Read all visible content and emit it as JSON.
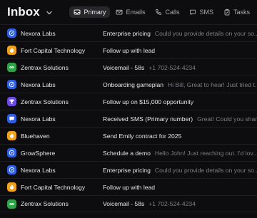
{
  "header": {
    "title": "Inbox",
    "tabs": [
      {
        "label": "Primary",
        "icon": "inbox-icon",
        "active": true
      },
      {
        "label": "Emails",
        "icon": "mail-icon",
        "active": false
      },
      {
        "label": "Calls",
        "icon": "phone-icon",
        "active": false
      },
      {
        "label": "SMS",
        "icon": "chat-icon",
        "active": false
      },
      {
        "label": "Tasks",
        "icon": "clipboard-icon",
        "active": false
      }
    ]
  },
  "colors": {
    "blue": "#2f5fe0",
    "orange": "#f0a21c",
    "green": "#2fa24a",
    "purple": "#6a4de0"
  },
  "rows": [
    {
      "company": "Nexora Labs",
      "subject": "Enterprise pricing",
      "preview": "Could you provide details on your so...",
      "avatar_color": "#2f5fe0",
      "avatar_icon": "compass-icon"
    },
    {
      "company": "Fort Capital Technology",
      "subject": "Follow up with lead",
      "preview": "",
      "avatar_color": "#f0a21c",
      "avatar_icon": "flame-icon"
    },
    {
      "company": "Zentrax Solutions",
      "subject": "Voicemail - 58s",
      "preview": "+1 702-524-4234",
      "avatar_color": "#2fa24a",
      "avatar_icon": "infinity-icon"
    },
    {
      "company": "Nexora Labs",
      "subject": "Onboarding gameplan",
      "preview": "Hi Bill, Great to hear! Just tried t...",
      "avatar_color": "#2f5fe0",
      "avatar_icon": "compass-icon"
    },
    {
      "company": "Zentrax Solutions",
      "subject": "Follow up on $15,000 opportunity",
      "preview": "",
      "avatar_color": "#6a4de0",
      "avatar_icon": "trophy-icon"
    },
    {
      "company": "Nexora Labs",
      "subject": "Received SMS (Primary number)",
      "preview": "Great! Could you shar...",
      "avatar_color": "#2f5fe0",
      "avatar_icon": "chat-icon"
    },
    {
      "company": "Bluehaven",
      "subject": "Send Emily contract for 2025",
      "preview": "",
      "avatar_color": "#f0a21c",
      "avatar_icon": "flame-icon"
    },
    {
      "company": "GrowSphere",
      "subject": "Schedule a demo",
      "preview": "Hello John! Just reaching out. I'd lov...",
      "avatar_color": "#2f5fe0",
      "avatar_icon": "compass-icon"
    },
    {
      "company": "Nexora Labs",
      "subject": "Enterprise pricing",
      "preview": "Could you provide details on your so...",
      "avatar_color": "#2f5fe0",
      "avatar_icon": "compass-icon"
    },
    {
      "company": "Fort Capital Technology",
      "subject": "Follow up with lead",
      "preview": "",
      "avatar_color": "#f0a21c",
      "avatar_icon": "flame-icon"
    },
    {
      "company": "Zentrax Solutions",
      "subject": "Voicemail - 58s",
      "preview": "+1 702-524-4234",
      "avatar_color": "#2fa24a",
      "avatar_icon": "infinity-icon"
    }
  ]
}
